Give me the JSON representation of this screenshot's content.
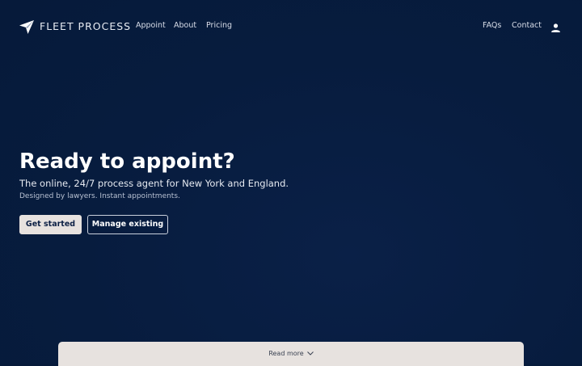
{
  "brand": {
    "name": "FLEET PROCESS",
    "logo_icon": "paper-plane-icon"
  },
  "nav": {
    "left_links": [
      "Appoint",
      "About",
      "Pricing"
    ],
    "right_links": [
      "FAQs",
      "Contact"
    ],
    "account_icon": "user-icon"
  },
  "hero": {
    "title": "Ready to appoint?",
    "subtitle": "The online, 24/7 process agent for New York and England.",
    "note": "Designed by lawyers. Instant appointments.",
    "primary_button": "Get started",
    "secondary_button": "Manage existing"
  },
  "read_more": {
    "label": "Read more",
    "icon": "chevron-down-icon"
  },
  "colors": {
    "background": "#071c3e",
    "primary_button_bg": "#e7e2df",
    "primary_button_text": "#0b1f44",
    "text": "#ffffff"
  }
}
